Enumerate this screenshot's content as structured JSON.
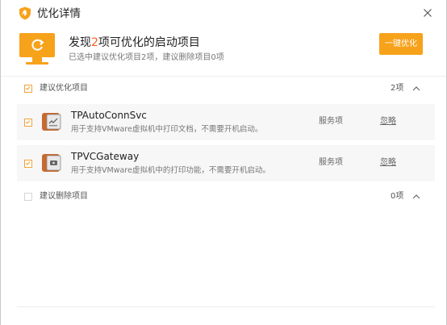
{
  "window": {
    "title": "优化详情"
  },
  "header": {
    "headline_prefix": "发现",
    "headline_count": "2",
    "headline_suffix": "项可优化的启动项目",
    "subline": "已选中建议优化项目2项，建议删除项目0项",
    "fix_button": "一键优化"
  },
  "sections": [
    {
      "label": "建议优化项目",
      "count": "2项",
      "checked": true,
      "expanded": true,
      "items": [
        {
          "name": "TPAutoConnSvc",
          "desc": "用于支持VMware虚拟机中打印文档，不需要开机启动。",
          "type": "服务项",
          "action": "忽略",
          "checked": true,
          "icon": "service-icon"
        },
        {
          "name": "TPVCGateway",
          "desc": "用于支持VMware虚拟机中的打印功能，不需要开机启动。",
          "type": "服务项",
          "action": "忽略",
          "checked": true,
          "icon": "service-icon"
        }
      ]
    },
    {
      "label": "建议删除项目",
      "count": "0项",
      "checked": false,
      "expanded": true,
      "items": []
    }
  ],
  "colors": {
    "accent": "#f7a21b",
    "highlight": "#ff5a1f",
    "row_bg": "#f7f7f7"
  }
}
